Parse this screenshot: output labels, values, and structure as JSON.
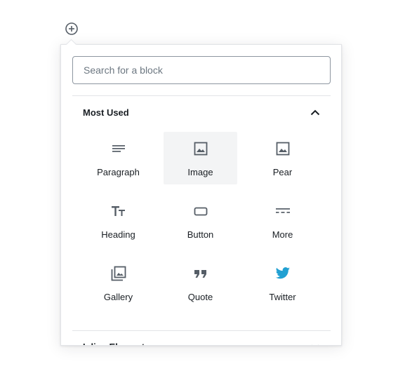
{
  "inserter": {
    "toggle_icon": "plus-circle-icon"
  },
  "search": {
    "placeholder": "Search for a block",
    "value": ""
  },
  "panels": {
    "most_used": {
      "title": "Most Used",
      "expanded": true,
      "blocks": [
        {
          "label": "Paragraph",
          "icon": "paragraph-icon"
        },
        {
          "label": "Image",
          "icon": "image-icon"
        },
        {
          "label": "Pear",
          "icon": "image-icon"
        },
        {
          "label": "Heading",
          "icon": "heading-icon"
        },
        {
          "label": "Button",
          "icon": "button-icon"
        },
        {
          "label": "More",
          "icon": "more-icon"
        },
        {
          "label": "Gallery",
          "icon": "gallery-icon"
        },
        {
          "label": "Quote",
          "icon": "quote-icon"
        },
        {
          "label": "Twitter",
          "icon": "twitter-icon"
        }
      ]
    },
    "inline_elements": {
      "title": "Inline Elements",
      "expanded": false
    }
  },
  "colors": {
    "text": "#191e23",
    "icon": "#555d66",
    "twitter": "#21a0d2",
    "hover_bg": "#f3f4f5",
    "border": "#e2e4e7"
  }
}
